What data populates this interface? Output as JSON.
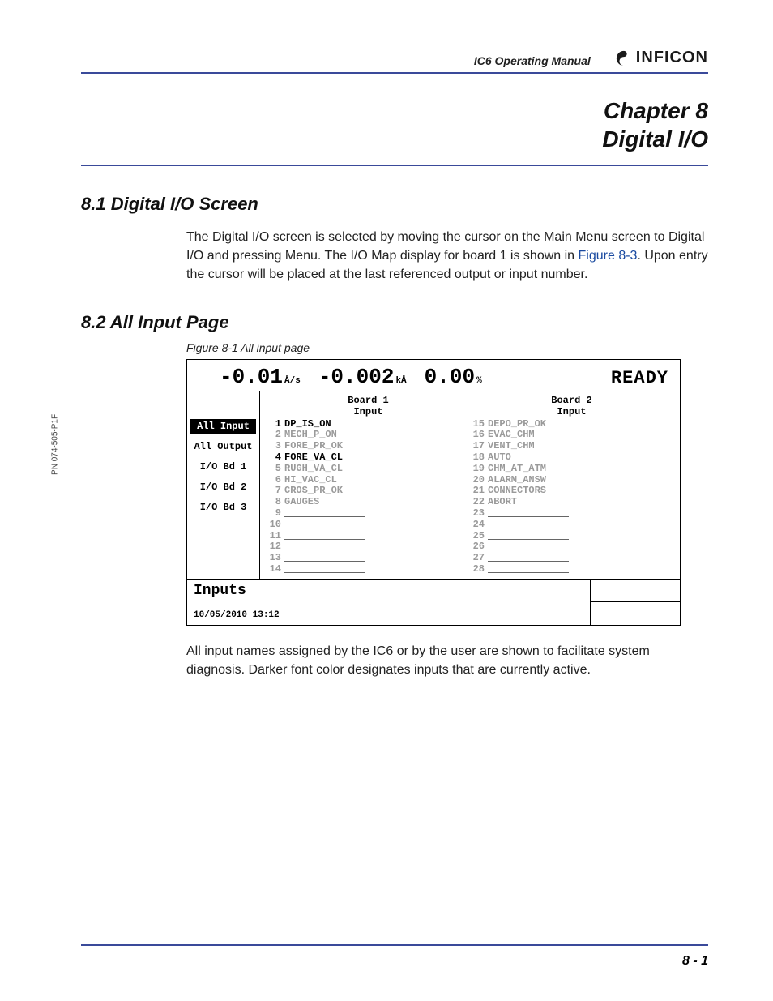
{
  "header": {
    "manual_title": "IC6 Operating Manual",
    "brand": "INFICON"
  },
  "side_pn": "PN 074-505-P1F",
  "chapter": {
    "line1": "Chapter 8",
    "line2": "Digital I/O"
  },
  "section1": {
    "heading": "8.1  Digital I/O Screen",
    "para_before": "The Digital I/O screen is selected by moving the cursor on the Main Menu screen to Digital I/O and pressing Menu. The I/O Map display for board 1 is shown in ",
    "figref": "Figure 8-3",
    "para_after": ". Upon entry the cursor will be placed at the last referenced output or input number."
  },
  "section2": {
    "heading": "8.2  All Input Page",
    "fig_caption": "Figure 8-1  All input page"
  },
  "screen": {
    "rate_val": "-0.01",
    "rate_unit": "Å/s",
    "thick_val": "-0.002",
    "thick_unit": "kÅ",
    "pct_val": "0.00",
    "pct_unit": "%",
    "status": "READY",
    "nav": [
      {
        "label": "All Input",
        "selected": true
      },
      {
        "label": "All Output",
        "selected": false
      },
      {
        "label": "I/O Bd 1",
        "selected": false
      },
      {
        "label": "I/O Bd 2",
        "selected": false
      },
      {
        "label": "I/O Bd 3",
        "selected": false
      }
    ],
    "board1_head": "Board 1\nInput",
    "board2_head": "Board 2\nInput",
    "board1": [
      {
        "n": "1",
        "name": "DP_IS_ON",
        "active": true
      },
      {
        "n": "2",
        "name": "MECH_P_ON",
        "active": false
      },
      {
        "n": "3",
        "name": "FORE_PR_OK",
        "active": false
      },
      {
        "n": "4",
        "name": "FORE_VA_CL",
        "active": true
      },
      {
        "n": "5",
        "name": "RUGH_VA_CL",
        "active": false
      },
      {
        "n": "6",
        "name": "HI_VAC_CL",
        "active": false
      },
      {
        "n": "7",
        "name": "CROS_PR_OK",
        "active": false
      },
      {
        "n": "8",
        "name": "GAUGES",
        "active": false
      },
      {
        "n": "9",
        "name": "",
        "active": false
      },
      {
        "n": "10",
        "name": "",
        "active": false
      },
      {
        "n": "11",
        "name": "",
        "active": false
      },
      {
        "n": "12",
        "name": "",
        "active": false
      },
      {
        "n": "13",
        "name": "",
        "active": false
      },
      {
        "n": "14",
        "name": "",
        "active": false
      }
    ],
    "board2": [
      {
        "n": "15",
        "name": "DEPO_PR_OK",
        "active": false
      },
      {
        "n": "16",
        "name": "EVAC_CHM",
        "active": false
      },
      {
        "n": "17",
        "name": "VENT_CHM",
        "active": false
      },
      {
        "n": "18",
        "name": "AUTO",
        "active": false
      },
      {
        "n": "19",
        "name": "CHM_AT_ATM",
        "active": false
      },
      {
        "n": "20",
        "name": "ALARM_ANSW",
        "active": false
      },
      {
        "n": "21",
        "name": "CONNECTORS",
        "active": false
      },
      {
        "n": "22",
        "name": "ABORT",
        "active": false
      },
      {
        "n": "23",
        "name": "",
        "active": false
      },
      {
        "n": "24",
        "name": "",
        "active": false
      },
      {
        "n": "25",
        "name": "",
        "active": false
      },
      {
        "n": "26",
        "name": "",
        "active": false
      },
      {
        "n": "27",
        "name": "",
        "active": false
      },
      {
        "n": "28",
        "name": "",
        "active": false
      }
    ],
    "footer_label": "Inputs",
    "timestamp": "10/05/2010  13:12"
  },
  "para2": "All input names assigned by the IC6 or by the user are shown to facilitate system diagnosis. Darker font color designates inputs that are currently active.",
  "page_num": "8 - 1"
}
